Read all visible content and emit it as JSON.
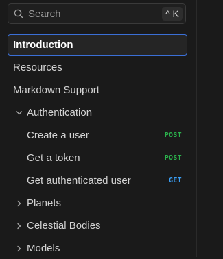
{
  "search": {
    "placeholder": "Search",
    "shortcut": "^ K",
    "icon": "search-icon"
  },
  "nav": {
    "items": [
      {
        "label": "Introduction",
        "active": true
      },
      {
        "label": "Resources"
      },
      {
        "label": "Markdown Support"
      }
    ],
    "groups": [
      {
        "label": "Authentication",
        "expanded": true,
        "icon": "chevron-down-icon",
        "children": [
          {
            "label": "Create a user",
            "method": "POST"
          },
          {
            "label": "Get a token",
            "method": "POST"
          },
          {
            "label": "Get authenticated user",
            "method": "GET"
          }
        ]
      },
      {
        "label": "Planets",
        "expanded": false,
        "icon": "chevron-right-icon"
      },
      {
        "label": "Celestial Bodies",
        "expanded": false,
        "icon": "chevron-right-icon"
      },
      {
        "label": "Models",
        "expanded": false,
        "icon": "chevron-right-icon"
      }
    ]
  },
  "colors": {
    "background": "#1a1a1a",
    "active_border": "#3b6fd6",
    "post": "#2bb24c",
    "get": "#3a9ff5"
  }
}
